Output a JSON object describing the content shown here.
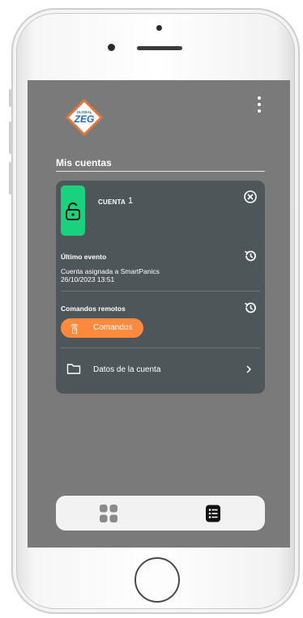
{
  "app": {
    "brand": {
      "small_text": "GLOBAL",
      "big_text": "ZEG"
    },
    "section_title": "Mis cuentas"
  },
  "account_card": {
    "account_label": "CUENTA",
    "account_number": "1",
    "last_event_title": "Último evento",
    "last_event_description": "Cuenta asignada a SmartPanics",
    "last_event_timestamp": "26/10/2023 13:51",
    "remote_commands_title": "Comandos remotos",
    "commands_button_label": "Comandos",
    "account_data_label": "Datos de la cuenta"
  },
  "icons": {
    "lock": "unlock-icon",
    "close": "close-circle-icon",
    "history": "history-icon",
    "remote": "remote-control-icon",
    "folder": "folder-icon",
    "chevron": "chevron-right-icon",
    "grid": "grid-icon",
    "list": "list-icon"
  },
  "colors": {
    "screen_bg": "#7a7a7a",
    "card_bg": "#4f5659",
    "status_green": "#19d17f",
    "accent_orange": "#ff8a3d",
    "logo_orange": "#e4783a",
    "logo_blue": "#2a6fb5"
  }
}
